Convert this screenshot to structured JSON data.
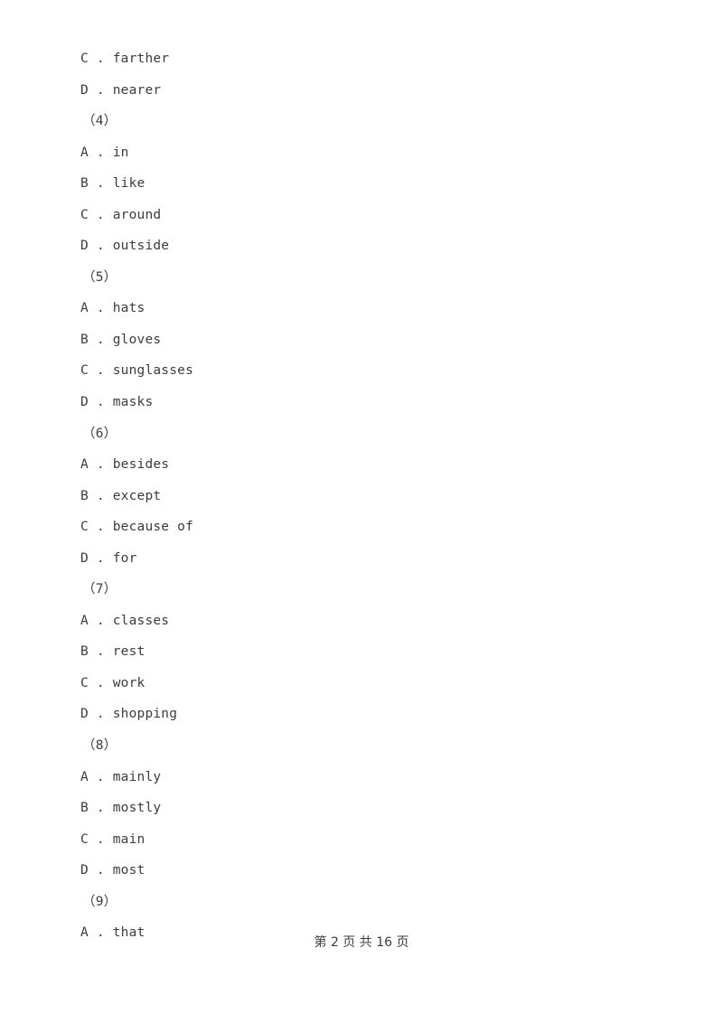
{
  "document": {
    "text_color": "#3c3c3c",
    "background_color": "#ffffff"
  },
  "lines": [
    {
      "kind": "option",
      "text": "C . farther"
    },
    {
      "kind": "option",
      "text": "D . nearer"
    },
    {
      "kind": "qnum",
      "text": "（4）"
    },
    {
      "kind": "option",
      "text": "A . in"
    },
    {
      "kind": "option",
      "text": "B . like"
    },
    {
      "kind": "option",
      "text": "C . around"
    },
    {
      "kind": "option",
      "text": "D . outside"
    },
    {
      "kind": "qnum",
      "text": "（5）"
    },
    {
      "kind": "option",
      "text": "A . hats"
    },
    {
      "kind": "option",
      "text": "B . gloves"
    },
    {
      "kind": "option",
      "text": "C . sunglasses"
    },
    {
      "kind": "option",
      "text": "D . masks"
    },
    {
      "kind": "qnum",
      "text": "（6）"
    },
    {
      "kind": "option",
      "text": "A . besides"
    },
    {
      "kind": "option",
      "text": "B . except"
    },
    {
      "kind": "option",
      "text": "C . because of"
    },
    {
      "kind": "option",
      "text": "D . for"
    },
    {
      "kind": "qnum",
      "text": "（7）"
    },
    {
      "kind": "option",
      "text": "A . classes"
    },
    {
      "kind": "option",
      "text": "B . rest"
    },
    {
      "kind": "option",
      "text": "C . work"
    },
    {
      "kind": "option",
      "text": "D . shopping"
    },
    {
      "kind": "qnum",
      "text": "（8）"
    },
    {
      "kind": "option",
      "text": "A . mainly"
    },
    {
      "kind": "option",
      "text": "B . mostly"
    },
    {
      "kind": "option",
      "text": "C . main"
    },
    {
      "kind": "option",
      "text": "D . most"
    },
    {
      "kind": "qnum",
      "text": "（9）"
    },
    {
      "kind": "option",
      "text": "A . that"
    }
  ],
  "footer": {
    "text": "第 2 页 共 16 页",
    "current_page": "2",
    "total_pages": "16"
  }
}
